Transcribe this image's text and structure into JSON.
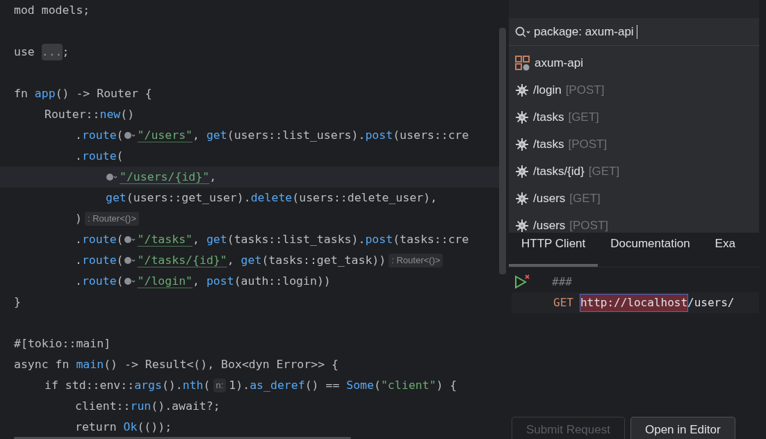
{
  "editor": {
    "lines": [
      {
        "kind": "code",
        "highlighted": false,
        "segments": [
          {
            "kind": "code",
            "text": "mod models;"
          }
        ]
      },
      {
        "kind": "blank",
        "highlighted": false
      },
      {
        "kind": "code",
        "highlighted": false,
        "segments": [
          {
            "kind": "code",
            "text": "use "
          },
          {
            "kind": "fold",
            "text": "..."
          },
          {
            "kind": "code",
            "text": ";"
          }
        ]
      },
      {
        "kind": "blank",
        "highlighted": false
      },
      {
        "kind": "code",
        "highlighted": false,
        "segments": [
          {
            "kind": "code",
            "text": "fn app() -> Router {"
          }
        ],
        "children": [
          {
            "kind": "code",
            "highlighted": false,
            "segments": [
              {
                "kind": "code",
                "text": "Router::new()"
              }
            ],
            "children": [
              {
                "kind": "code",
                "highlighted": false,
                "segments": [
                  {
                    "kind": "code",
                    "text": ".route("
                  },
                  {
                    "kind": "route",
                    "text": "\"/users\""
                  },
                  {
                    "kind": "code",
                    "text": ", get(users::list_users).post(users::cre"
                  }
                ]
              },
              {
                "kind": "code",
                "highlighted": false,
                "segments": [
                  {
                    "kind": "code",
                    "text": ".route("
                  }
                ],
                "children": [
                  {
                    "kind": "code",
                    "highlighted": true,
                    "segments": [
                      {
                        "kind": "route",
                        "text": "\"/users/{id}\""
                      },
                      {
                        "kind": "code",
                        "text": ","
                      }
                    ]
                  },
                  {
                    "kind": "code",
                    "highlighted": false,
                    "segments": [
                      {
                        "kind": "code",
                        "text": "get(users::get_user).delete(users::delete_user),"
                      }
                    ]
                  }
                ]
              },
              {
                "kind": "code",
                "highlighted": false,
                "segments": [
                  {
                    "kind": "code",
                    "text": ")"
                  },
                  {
                    "kind": "hint",
                    "text": ": Router<()>"
                  }
                ]
              },
              {
                "kind": "code",
                "highlighted": false,
                "segments": [
                  {
                    "kind": "code",
                    "text": ".route("
                  },
                  {
                    "kind": "route",
                    "text": "\"/tasks\""
                  },
                  {
                    "kind": "code",
                    "text": ", get(tasks::list_tasks).post(tasks::cre"
                  }
                ]
              },
              {
                "kind": "code",
                "highlighted": false,
                "segments": [
                  {
                    "kind": "code",
                    "text": ".route("
                  },
                  {
                    "kind": "route",
                    "text": "\"/tasks/{id}\""
                  },
                  {
                    "kind": "code",
                    "text": ", get(tasks::get_task))"
                  },
                  {
                    "kind": "hint",
                    "text": ": Router<()>"
                  }
                ]
              },
              {
                "kind": "code",
                "highlighted": false,
                "segments": [
                  {
                    "kind": "code",
                    "text": ".route("
                  },
                  {
                    "kind": "route",
                    "text": "\"/login\""
                  },
                  {
                    "kind": "code",
                    "text": ", post(auth::login))"
                  }
                ]
              }
            ]
          }
        ]
      },
      {
        "kind": "code",
        "highlighted": false,
        "segments": [
          {
            "kind": "code",
            "text": "}"
          }
        ]
      },
      {
        "kind": "blank",
        "highlighted": false
      },
      {
        "kind": "code",
        "highlighted": false,
        "segments": [
          {
            "kind": "code",
            "text": "#[tokio::main]"
          }
        ]
      },
      {
        "kind": "code",
        "highlighted": false,
        "segments": [
          {
            "kind": "code",
            "text": "async fn main() -> Result<(), Box<dyn Error>> {"
          }
        ],
        "children": [
          {
            "kind": "code",
            "highlighted": false,
            "segments": [
              {
                "kind": "code",
                "text": "if std::env::args().nth("
              },
              {
                "kind": "hint",
                "text": "n:"
              },
              {
                "kind": "code",
                "text": "1).as_deref() == Some(\"client\") {"
              }
            ],
            "children": [
              {
                "kind": "code",
                "highlighted": false,
                "segments": [
                  {
                    "kind": "code",
                    "text": "client::run().await?;"
                  }
                ]
              },
              {
                "kind": "code",
                "highlighted": false,
                "segments": [
                  {
                    "kind": "code",
                    "text": "return Ok(());"
                  }
                ]
              }
            ]
          }
        ]
      }
    ]
  },
  "popup": {
    "search": {
      "value": "package: axum-api"
    },
    "items": [
      {
        "kind": "package",
        "label": "axum-api"
      },
      {
        "kind": "endpoint",
        "label": "/login",
        "method": "[POST]"
      },
      {
        "kind": "endpoint",
        "label": "/tasks",
        "method": "[GET]"
      },
      {
        "kind": "endpoint",
        "label": "/tasks",
        "method": "[POST]"
      },
      {
        "kind": "endpoint",
        "label": "/tasks/{id}",
        "method": "[GET]"
      },
      {
        "kind": "endpoint",
        "label": "/users",
        "method": "[GET]"
      },
      {
        "kind": "endpoint",
        "label": "/users",
        "method": "[POST]"
      }
    ],
    "tabs": [
      {
        "label": "HTTP Client",
        "selected": true
      },
      {
        "label": "Documentation",
        "selected": false
      },
      {
        "label": "Exa",
        "selected": false
      }
    ],
    "http": {
      "separator": "###",
      "method": "GET",
      "host": "http://localhost",
      "path": "/users/"
    },
    "buttons": [
      {
        "label": "Submit Request",
        "disabled": true
      },
      {
        "label": "Open in Editor",
        "disabled": false
      }
    ]
  }
}
